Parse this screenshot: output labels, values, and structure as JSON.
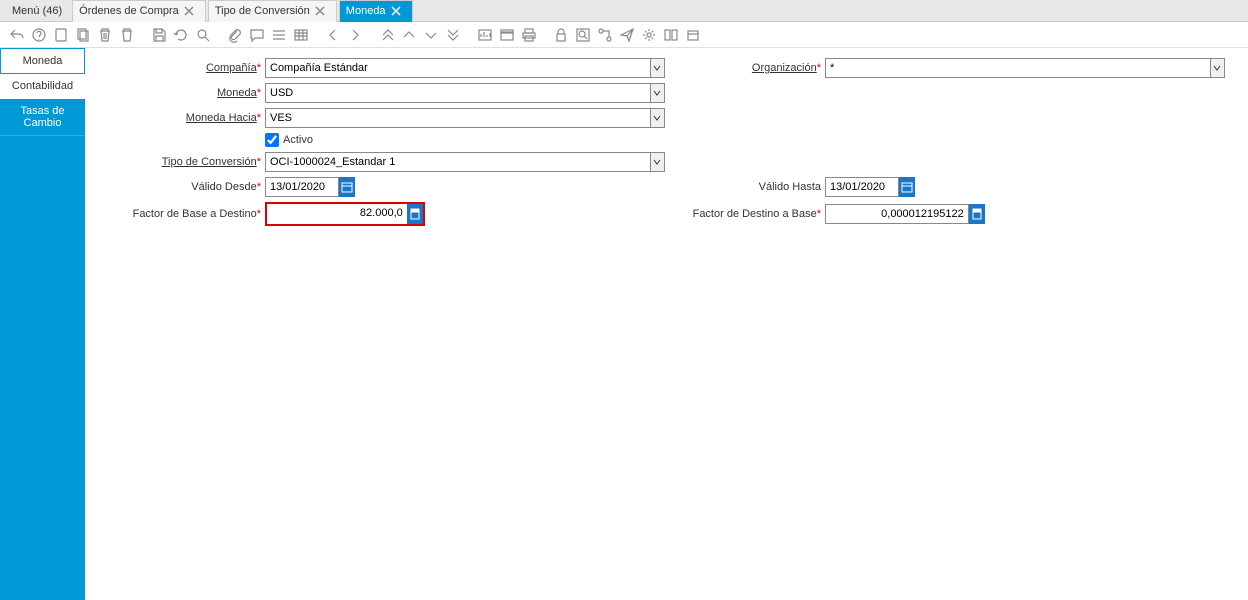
{
  "tabs": {
    "menu": "Menú (46)",
    "items": [
      {
        "label": "Órdenes de Compra"
      },
      {
        "label": "Tipo de Conversión"
      },
      {
        "label": "Moneda",
        "active": true
      }
    ]
  },
  "sidebar": {
    "items": [
      {
        "label": "Moneda",
        "style": "active"
      },
      {
        "label": "Contabilidad",
        "style": "white"
      },
      {
        "label": "Tasas de Cambio",
        "style": "selected"
      }
    ]
  },
  "form": {
    "compania": {
      "label": "Compañía",
      "value": "Compañía Estándar"
    },
    "organizacion": {
      "label": "Organización",
      "value": "*"
    },
    "moneda": {
      "label": "Moneda",
      "value": "USD"
    },
    "moneda_hacia": {
      "label": "Moneda Hacia",
      "value": "VES"
    },
    "activo": {
      "label": "Activo",
      "checked": true
    },
    "tipo_conversion": {
      "label": "Tipo de Conversión",
      "value": "OCI-1000024_Estandar 1"
    },
    "valido_desde": {
      "label": "Válido Desde",
      "value": "13/01/2020"
    },
    "valido_hasta": {
      "label": "Válido Hasta",
      "value": "13/01/2020"
    },
    "factor_base_destino": {
      "label": "Factor de Base a Destino",
      "value": "82.000,0"
    },
    "factor_destino_base": {
      "label": "Factor de Destino a Base",
      "value": "0,000012195122"
    }
  }
}
